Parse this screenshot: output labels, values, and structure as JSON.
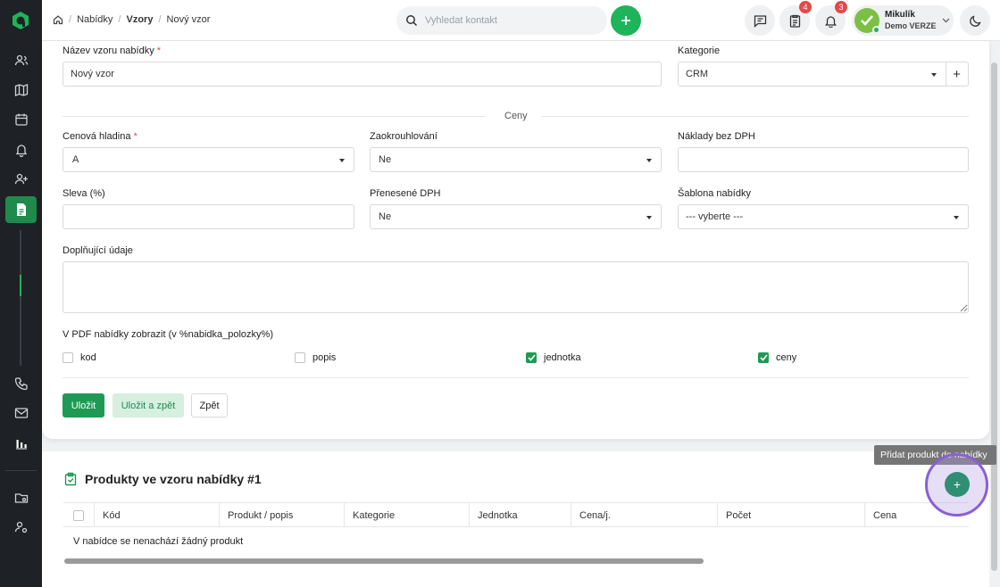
{
  "breadcrumb": {
    "items": [
      "Nabídky",
      "Vzory",
      "Nový vzor"
    ]
  },
  "search": {
    "placeholder": "Vyhledat kontakt"
  },
  "header": {
    "tasks_badge": "4",
    "notifications_badge": "3"
  },
  "user": {
    "name": "Mikulík",
    "subtitle": "Demo VERZE"
  },
  "form": {
    "name_label": "Název vzoru nabídky",
    "name_value": "Nový vzor",
    "category_label": "Kategorie",
    "category_value": "CRM",
    "section_label": "Ceny",
    "price_level_label": "Cenová hladina",
    "price_level_value": "A",
    "rounding_label": "Zaokrouhlování",
    "rounding_value": "Ne",
    "costs_label": "Náklady bez DPH",
    "costs_value": "",
    "discount_label": "Sleva (%)",
    "discount_value": "",
    "vat_label": "Přenesené DPH",
    "vat_value": "Ne",
    "template_label": "Šablona nabídky",
    "template_value": "--- vyberte ---",
    "extra_label": "Doplňující údaje",
    "pdf_label": "V PDF nabídky zobrazit (v %nabidka_polozky%)",
    "checkboxes": [
      {
        "label": "kod",
        "checked": false
      },
      {
        "label": "popis",
        "checked": false
      },
      {
        "label": "jednotka",
        "checked": true
      },
      {
        "label": "ceny",
        "checked": true
      }
    ],
    "save_label": "Uložit",
    "save_back_label": "Uložit a zpět",
    "back_label": "Zpět"
  },
  "products": {
    "title": "Produkty ve vzoru nabídky #1",
    "columns": [
      "Kód",
      "Produkt / popis",
      "Kategorie",
      "Jednotka",
      "Cena/j.",
      "Počet",
      "Cena"
    ],
    "empty_text": "V nabídce se nenachází žádný produkt",
    "add_tooltip": "Přidat produkt do nabídky"
  },
  "colors": {
    "accent": "#1db45a",
    "sidebar": "#1e2125",
    "highlight_ring": "#8b5fd6"
  }
}
